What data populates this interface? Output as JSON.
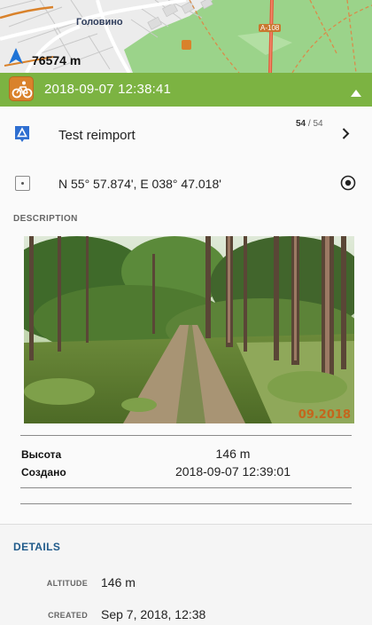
{
  "map": {
    "town_label": "Головино",
    "road_label": "А-108",
    "distance": "76574 m",
    "nav_icon": "navigation-arrow-icon"
  },
  "header": {
    "timestamp": "2018-09-07 12:38:41",
    "category_icon": "cycling-icon",
    "collapse_icon": "chevron-up-icon",
    "accent": "#7cb342"
  },
  "point": {
    "name": "Test reimport",
    "index": "54",
    "total": "54",
    "coordinates": "N 55° 57.874', E 038° 47.018'"
  },
  "description": {
    "heading": "DESCRIPTION",
    "photo_watermark": "09.2018",
    "fields": [
      {
        "label": "Высота",
        "value": "146 m"
      },
      {
        "label": "Создано",
        "value": "2018-09-07 12:39:01"
      }
    ]
  },
  "details": {
    "heading": "DETAILS",
    "rows": [
      {
        "label": "ALTITUDE",
        "value": "146 m"
      },
      {
        "label": "CREATED",
        "value": "Sep 7, 2018, 12:38"
      }
    ]
  }
}
